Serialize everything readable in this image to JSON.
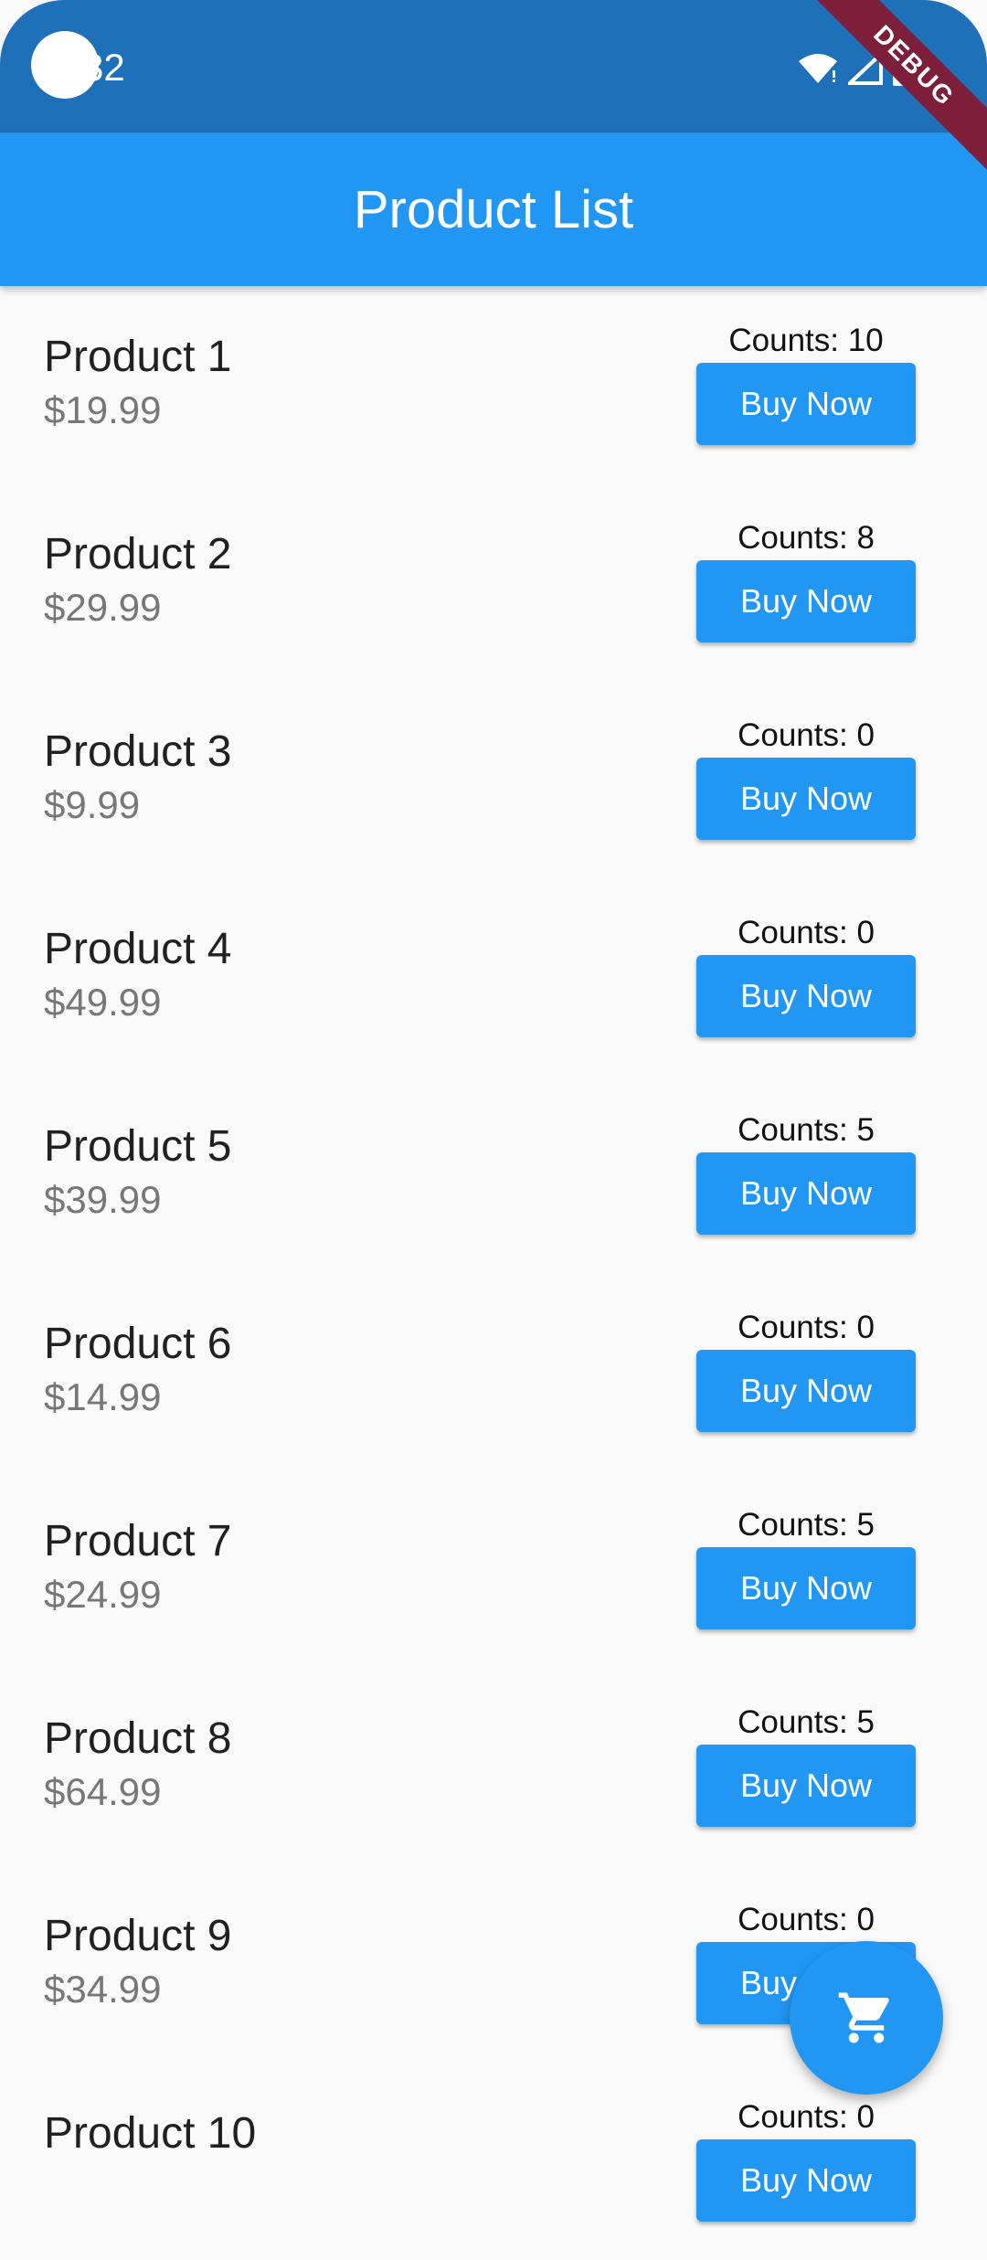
{
  "status_bar": {
    "time": "32"
  },
  "debug_banner": "DEBUG",
  "app_bar": {
    "title": "Product List"
  },
  "products": [
    {
      "name": "Product 1",
      "price": "$19.99",
      "counts": "Counts: 10",
      "button": "Buy Now"
    },
    {
      "name": "Product 2",
      "price": "$29.99",
      "counts": "Counts: 8",
      "button": "Buy Now"
    },
    {
      "name": "Product 3",
      "price": "$9.99",
      "counts": "Counts: 0",
      "button": "Buy Now"
    },
    {
      "name": "Product 4",
      "price": "$49.99",
      "counts": "Counts: 0",
      "button": "Buy Now"
    },
    {
      "name": "Product 5",
      "price": "$39.99",
      "counts": "Counts: 5",
      "button": "Buy Now"
    },
    {
      "name": "Product 6",
      "price": "$14.99",
      "counts": "Counts: 0",
      "button": "Buy Now"
    },
    {
      "name": "Product 7",
      "price": "$24.99",
      "counts": "Counts: 5",
      "button": "Buy Now"
    },
    {
      "name": "Product 8",
      "price": "$64.99",
      "counts": "Counts: 5",
      "button": "Buy Now"
    },
    {
      "name": "Product 9",
      "price": "$34.99",
      "counts": "Counts: 0",
      "button": "Buy Now"
    },
    {
      "name": "Product 10",
      "price": "",
      "counts": "Counts: 0",
      "button": "Buy Now"
    }
  ],
  "fab": {
    "icon": "cart-icon"
  },
  "colors": {
    "primary": "#2196f3",
    "status_bar": "#1e70b9",
    "debug": "#7d1f3a"
  }
}
